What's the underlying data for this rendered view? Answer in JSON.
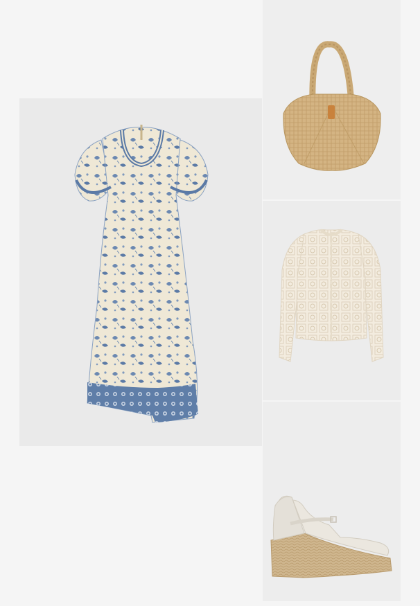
{
  "outfit": {
    "items": [
      {
        "name": "Dress"
      },
      {
        "name": "Bag"
      },
      {
        "name": "Cardigan"
      },
      {
        "name": "Espadrille"
      }
    ]
  },
  "colors": {
    "page_bg": "#f5f5f5",
    "panel_bg": "#ececec",
    "dress_base": "#efe8d6",
    "dress_print": "#5b7aa6",
    "bag_raffia": "#d4b483",
    "cardigan_cream": "#f3ecdf",
    "espadrille_jute": "#cfb68e"
  }
}
